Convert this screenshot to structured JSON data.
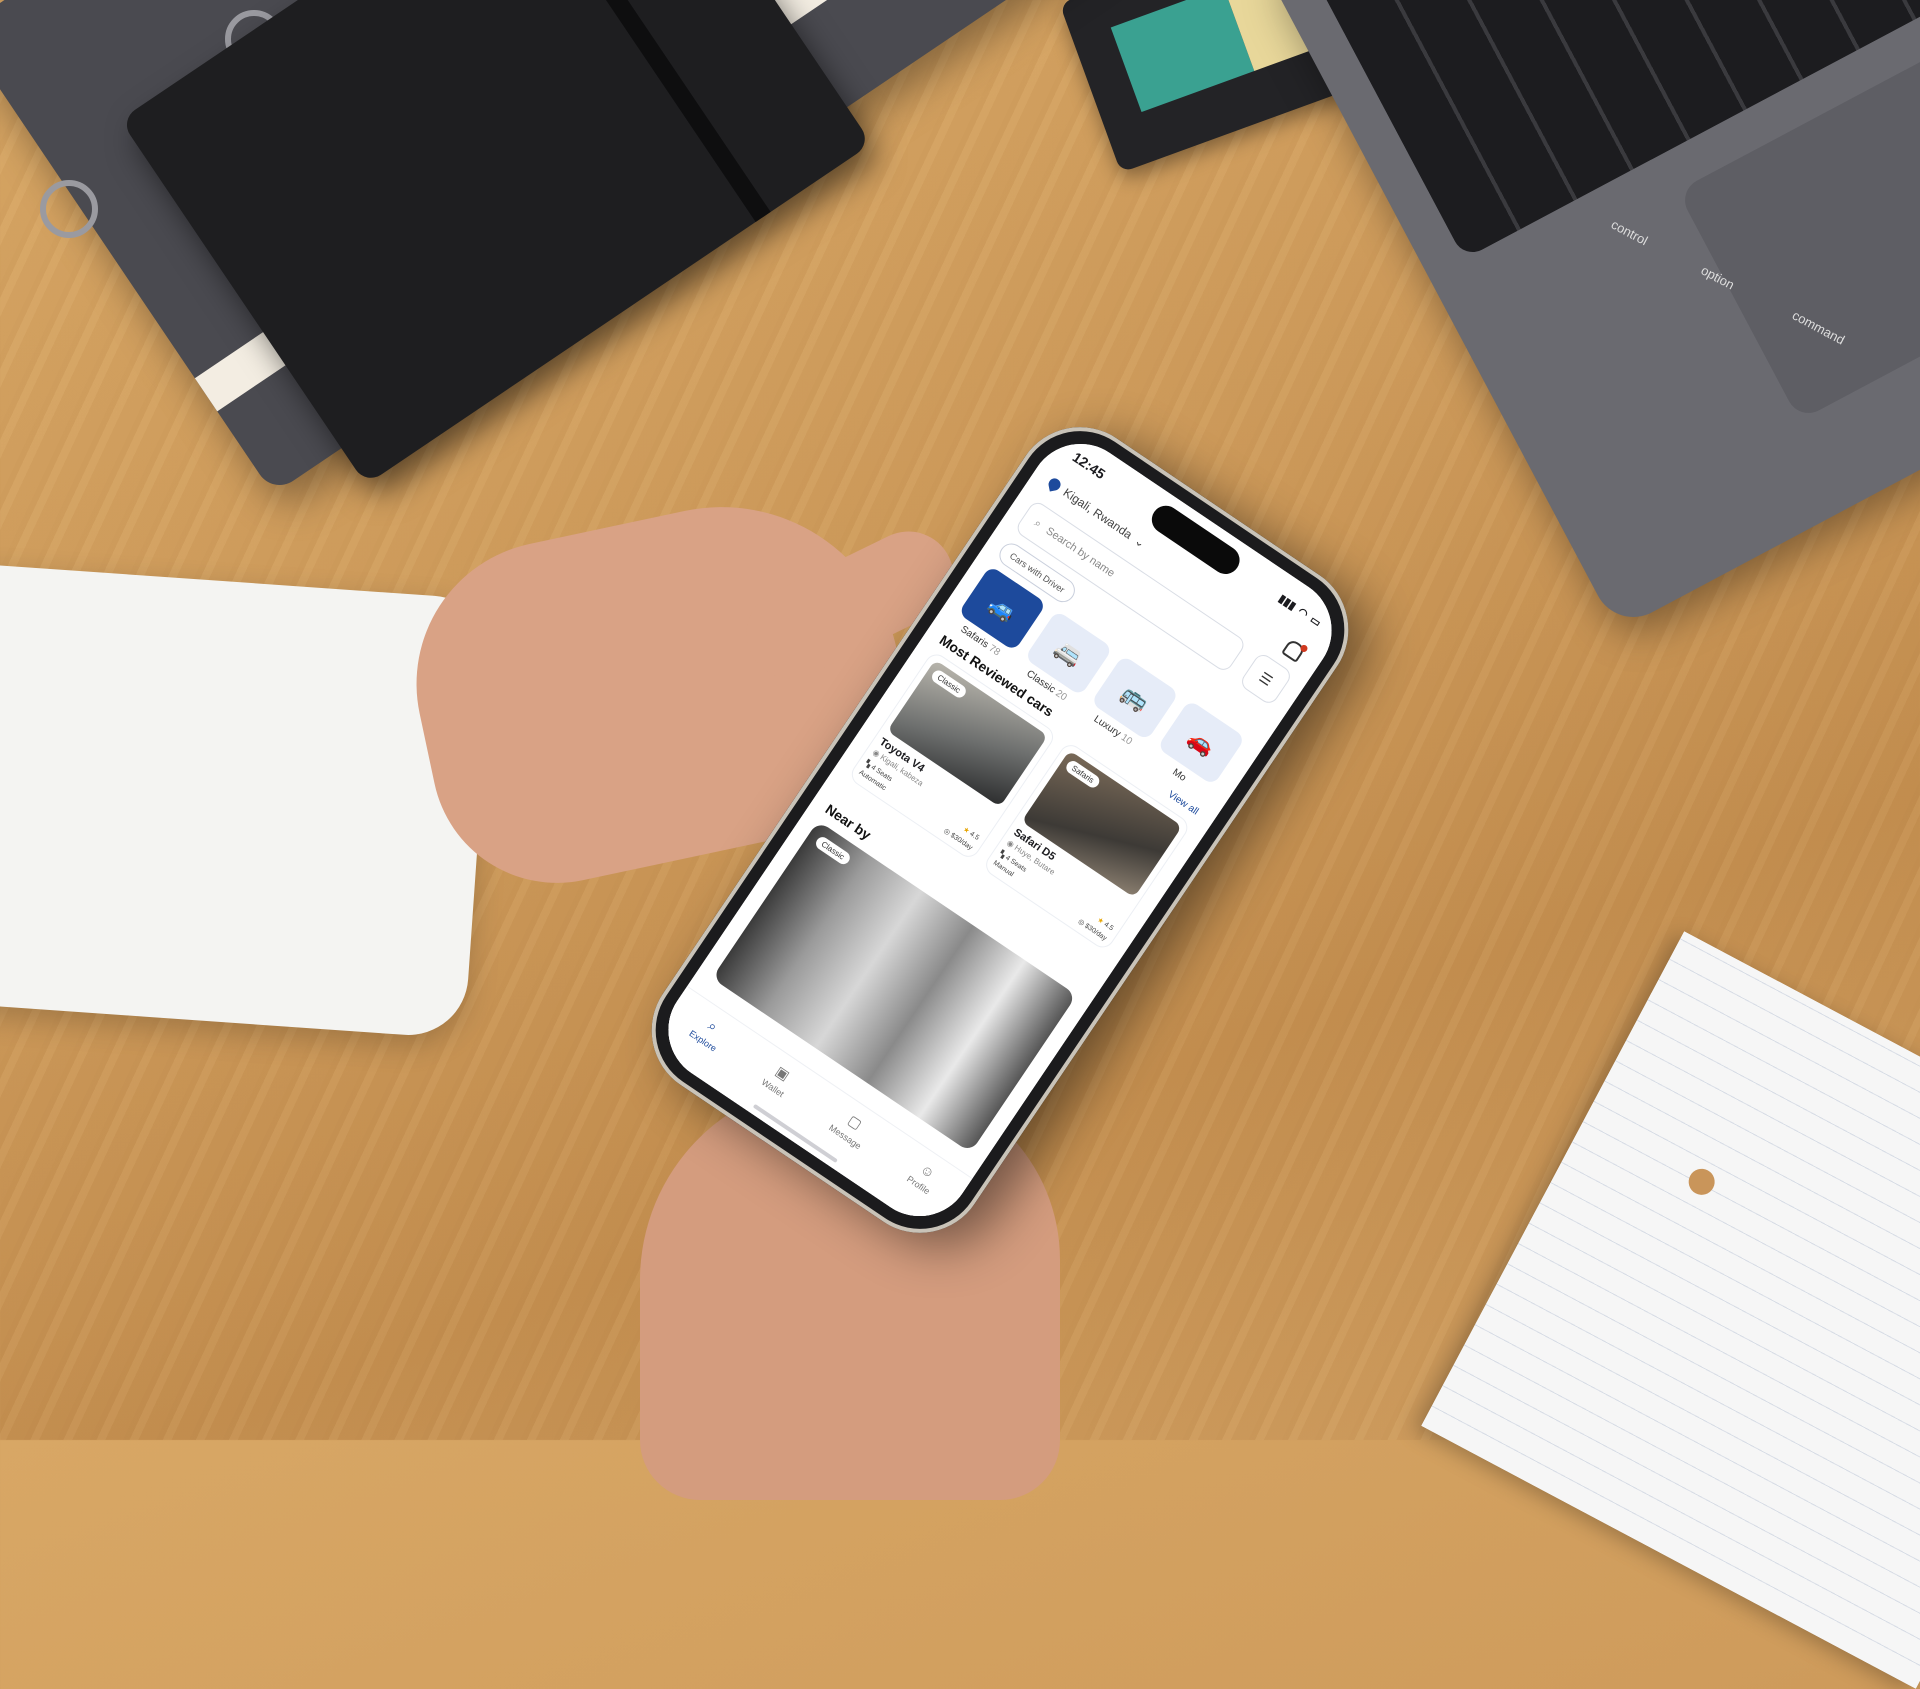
{
  "status_bar": {
    "time": "12:45"
  },
  "location": {
    "label": "Kigali, Rwanda",
    "chevron": "⌄"
  },
  "search": {
    "placeholder": "Search by name"
  },
  "filter_chip": "Cars with Driver",
  "categories": [
    {
      "label": "Safaris",
      "count": "78",
      "icon": "safari-car-icon",
      "active": true
    },
    {
      "label": "Classic",
      "count": "20",
      "icon": "classic-car-icon",
      "active": false
    },
    {
      "label": "Luxury",
      "count": "10",
      "icon": "luxury-car-icon",
      "active": false
    },
    {
      "label": "Mo",
      "count": "",
      "icon": "more-car-icon",
      "active": false
    }
  ],
  "most_reviewed": {
    "title": "Most Reviewed cars",
    "view_all": "View all",
    "cards": [
      {
        "badge": "Classic",
        "name": "Toyota V4",
        "place": "Kigali, kabeza",
        "seats": "4 Seats",
        "rating": "4.5",
        "transmission": "Automatic",
        "price": "$30/day"
      },
      {
        "badge": "Safaris",
        "name": "Safari D5",
        "place": "Huye, Butare",
        "seats": "4 Seats",
        "rating": "4.5",
        "transmission": "Manual",
        "price": "$30/day"
      }
    ]
  },
  "near_by": {
    "title": "Near by",
    "badge": "Classic"
  },
  "tabs": [
    {
      "label": "Explore",
      "icon": "search-icon",
      "active": true
    },
    {
      "label": "Wallet",
      "icon": "wallet-icon",
      "active": false
    },
    {
      "label": "Message",
      "icon": "message-icon",
      "active": false
    },
    {
      "label": "Profile",
      "icon": "profile-icon",
      "active": false
    }
  ],
  "colors": {
    "accent": "#1d4a9c",
    "notification_dot": "#d0391f"
  },
  "laptop_keys": {
    "control": "control",
    "option": "option",
    "command": "command"
  }
}
